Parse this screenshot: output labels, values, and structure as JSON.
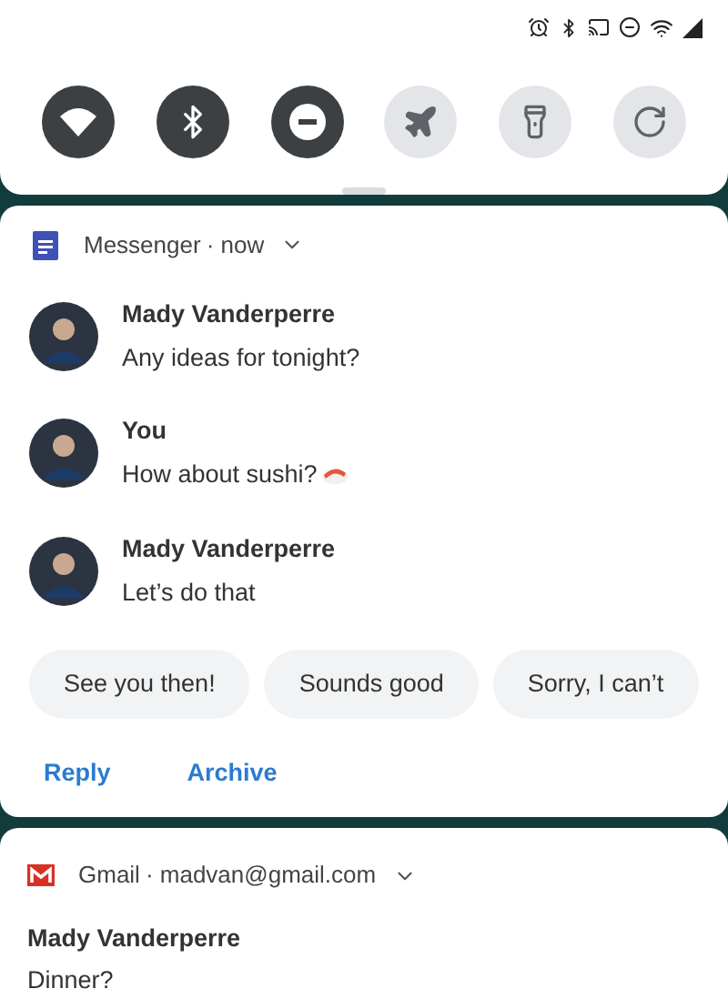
{
  "quick_settings": {
    "tiles": [
      {
        "kind": "wifi",
        "on": true
      },
      {
        "kind": "bluetooth",
        "on": true
      },
      {
        "kind": "dnd",
        "on": true
      },
      {
        "kind": "airplane",
        "on": false
      },
      {
        "kind": "flashlight",
        "on": false
      },
      {
        "kind": "rotate",
        "on": false
      }
    ]
  },
  "messenger": {
    "app": "Messenger",
    "time": "· now",
    "messages": [
      {
        "sender": "Mady Vanderperre",
        "text": "Any ideas for tonight?",
        "emoji": false
      },
      {
        "sender": "You",
        "text": "How about sushi?",
        "emoji": true
      },
      {
        "sender": "Mady Vanderperre",
        "text": "Let’s do that",
        "emoji": false
      }
    ],
    "smart_replies": [
      "See you then!",
      "Sounds good",
      "Sorry, I can’t"
    ],
    "actions": [
      "Reply",
      "Archive"
    ]
  },
  "gmail": {
    "app": "Gmail",
    "account": "· madvan@gmail.com",
    "sender": "Mady Vanderperre",
    "subject": "Dinner?"
  }
}
